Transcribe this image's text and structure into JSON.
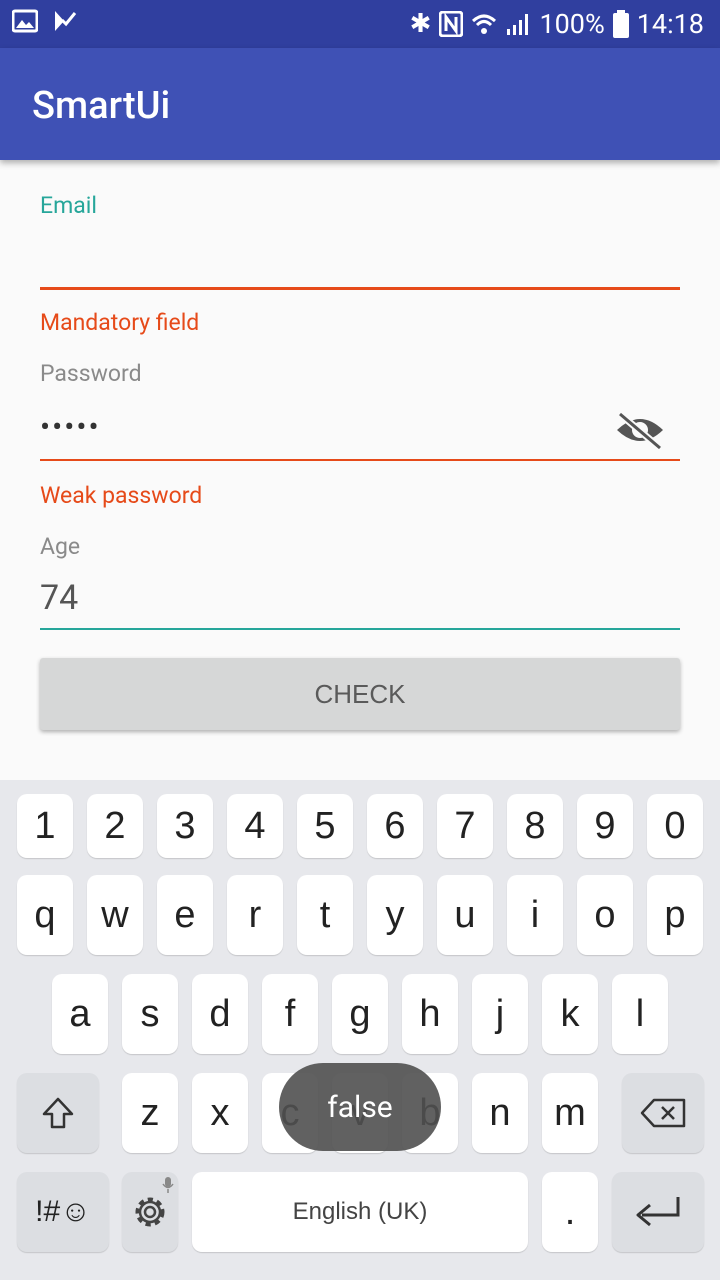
{
  "status_bar": {
    "battery": "100%",
    "time": "14:18"
  },
  "app_bar": {
    "title": "SmartUi"
  },
  "form": {
    "email": {
      "label": "Email",
      "value": "",
      "error": "Mandatory field"
    },
    "password": {
      "label": "Password",
      "masked_value": "•••••",
      "error": "Weak password"
    },
    "age": {
      "label": "Age",
      "value": "74"
    },
    "check_button": "CHECK"
  },
  "keyboard": {
    "number_row": [
      "1",
      "2",
      "3",
      "4",
      "5",
      "6",
      "7",
      "8",
      "9",
      "0"
    ],
    "row1": [
      "q",
      "w",
      "e",
      "r",
      "t",
      "y",
      "u",
      "i",
      "o",
      "p"
    ],
    "row2": [
      "a",
      "s",
      "d",
      "f",
      "g",
      "h",
      "j",
      "k",
      "l"
    ],
    "row3": [
      "z",
      "x",
      "c",
      "v",
      "b",
      "n",
      "m"
    ],
    "symbols_key": "!#☺",
    "space_label": "English (UK)",
    "period": "."
  },
  "toast": "false",
  "colors": {
    "primary": "#3f51b5",
    "primary_dark": "#303f9f",
    "accent": "#26a69a",
    "error": "#e64a19"
  }
}
